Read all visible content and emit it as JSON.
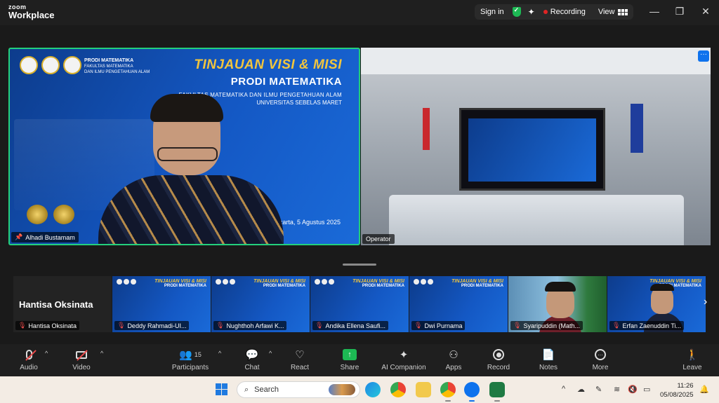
{
  "app": {
    "logo_line1": "zoom",
    "logo_line2": "Workplace",
    "signin_label": "Sign in",
    "recording_label": "Recording",
    "view_label": "View"
  },
  "window_controls": [
    "—",
    "❐",
    "✕"
  ],
  "main_slide": {
    "title": "TINJAUAN VISI & MISI",
    "program": "PRODI MATEMATIKA",
    "faculty": "FAKULTAS MATEMATIKA DAN ILMU PENGETAHUAN ALAM",
    "university": "UNIVERSITAS SEBELAS MARET",
    "org_name": "PRODI MATEMATIKA",
    "org_line2": "FAKULTAS MATEMATIKA",
    "org_line3": "DAN ILMU PENGETAHUAN ALAM",
    "date_line": "urakarta, 5 Agustus 2025"
  },
  "tiles": {
    "left_name": "Alhadi Bustamam",
    "right_name": "Operator",
    "more_label": "···"
  },
  "thumbnails": [
    {
      "type": "blank",
      "big_name": "Hantisa Oksinata",
      "name": "Hantisa Oksinata"
    },
    {
      "type": "slide",
      "name": "Deddy Rahmadi-UI..."
    },
    {
      "type": "slide",
      "name": "Nughthoh Arfawi K..."
    },
    {
      "type": "slide",
      "name": "Andika Ellena Saufi..."
    },
    {
      "type": "slide",
      "name": "Dwi Purnama"
    },
    {
      "type": "cam1",
      "name": "Syaripuddin (Math..."
    },
    {
      "type": "cam2",
      "name": "Erfan Zaenuddin Ti..."
    }
  ],
  "thumb_slide_text": {
    "a": "TINJAUAN VISI & MISI",
    "b": "PRODI MATEMATIKA"
  },
  "toolbar": {
    "audio": "Audio",
    "video": "Video",
    "participants": "Participants",
    "participants_count": "15",
    "chat": "Chat",
    "react": "React",
    "share": "Share",
    "ai_companion": "AI Companion",
    "apps": "Apps",
    "record": "Record",
    "notes": "Notes",
    "more": "More",
    "leave": "Leave"
  },
  "taskbar": {
    "search_label": "Search",
    "time": "11:26",
    "date": "05/08/2025"
  },
  "colors": {
    "active_speaker_border": "#23d07d",
    "recording_dot": "#e02424",
    "share_green": "#1db954",
    "zoom_blue": "#0e72ed"
  }
}
